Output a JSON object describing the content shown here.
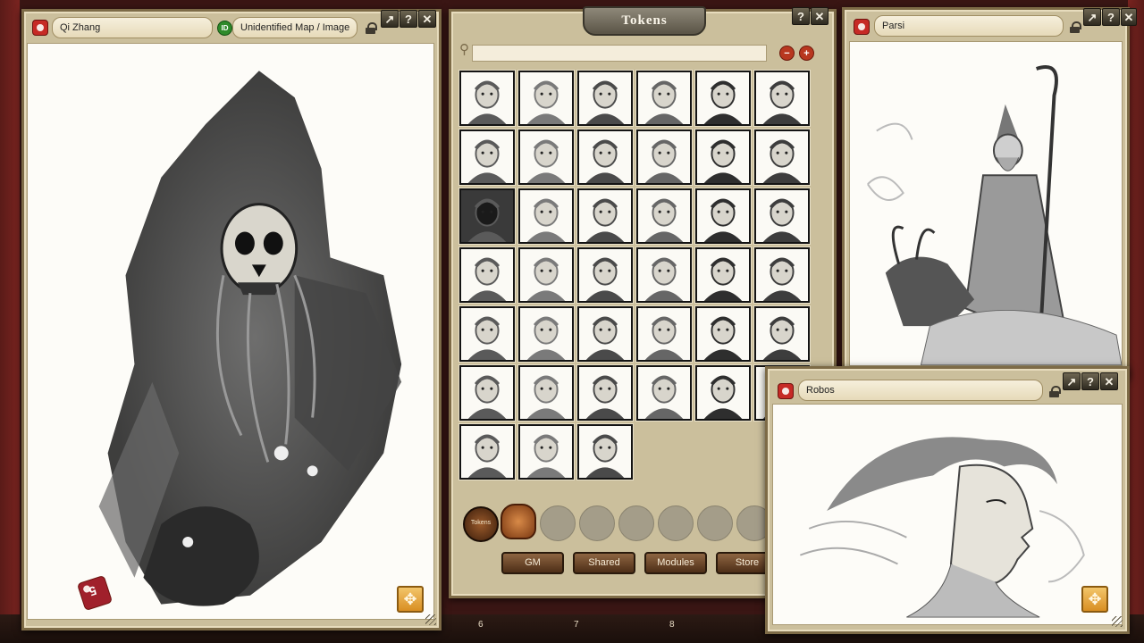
{
  "windows": {
    "left": {
      "title": "Qi Zhang",
      "id_badge": "ID",
      "subtitle": "Unidentified Map / Image"
    },
    "tokens": {
      "title": "Tokens",
      "search_value": "",
      "tabs": [
        "GM",
        "Shared",
        "Modules",
        "Store"
      ],
      "bag_token_label": "Tokens"
    },
    "right_top": {
      "title": "Parsi"
    },
    "right_bottom": {
      "title": "Robos"
    }
  },
  "buttons": {
    "popout": "↗",
    "help": "?",
    "close": "✕",
    "zoom_out": "−",
    "zoom_in": "+"
  },
  "dice": {
    "value": "5"
  },
  "hotbar": {
    "slots": [
      "6",
      "7",
      "8"
    ]
  },
  "colors": {
    "frame": "#cbbf9c",
    "desktop": "#3a1614",
    "accent_gold": "#d98e22",
    "tab_brown": "#6e4a2c"
  }
}
